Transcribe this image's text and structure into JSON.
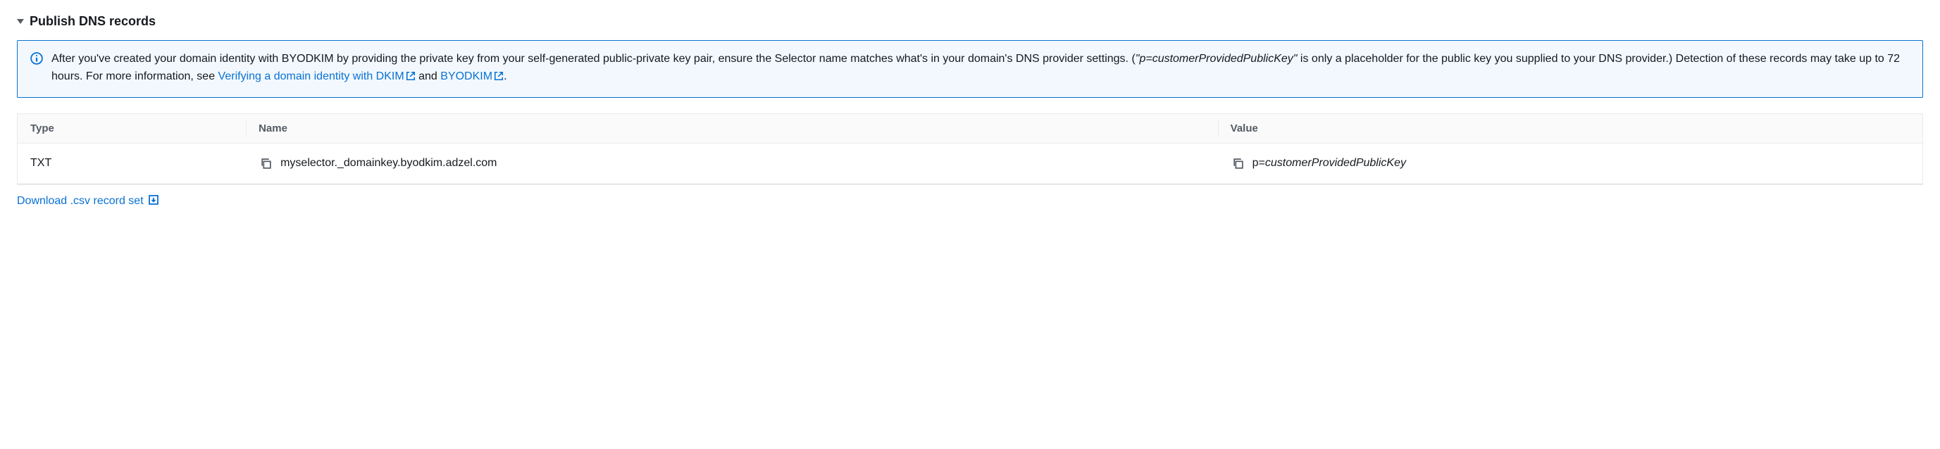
{
  "section": {
    "title": "Publish DNS records"
  },
  "banner": {
    "text_before_em": "After you've created your domain identity with BYODKIM by providing the private key from your self-generated public-private key pair, ensure the Selector name matches what's in your domain's DNS provider settings. (",
    "em_text": "\"p=customerProvidedPublicKey\"",
    "text_after_em": " is only a placeholder for the public key you supplied to your DNS provider.) Detection of these records may take up to 72 hours. For more information, see ",
    "link1": "Verifying a domain identity with DKIM",
    "between_links": " and ",
    "link2": "BYODKIM",
    "after_links": "."
  },
  "table": {
    "headers": {
      "type": "Type",
      "name": "Name",
      "value": "Value"
    },
    "row": {
      "type": "TXT",
      "name": "myselector._domainkey.byodkim.adzel.com",
      "value_prefix": "p=",
      "value_em": "customerProvidedPublicKey"
    }
  },
  "download": {
    "label": "Download .csv record set"
  }
}
